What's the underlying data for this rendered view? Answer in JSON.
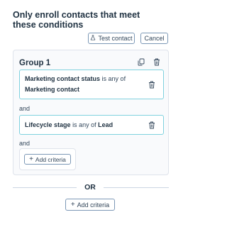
{
  "heading": "Only enroll contacts that meet these conditions",
  "toolbar": {
    "test_label": "Test contact",
    "cancel_label": "Cancel"
  },
  "group": {
    "title": "Group 1",
    "criteria": [
      {
        "property": "Marketing contact status",
        "operator": "is any of",
        "value": "Marketing contact"
      },
      {
        "property": "Lifecycle stage",
        "operator": "is any of",
        "value": "Lead"
      }
    ],
    "connectors": [
      "and",
      "and"
    ],
    "add_criteria_label": "Add criteria"
  },
  "or_label": "OR",
  "add_criteria_label": "Add criteria",
  "colors": {
    "criteria_border": "#7fd1de",
    "button_border": "#7c98b6",
    "text": "#33475b",
    "heading": "#213343"
  },
  "icons": [
    "flask-icon",
    "copy-icon",
    "trash-icon",
    "plus-icon"
  ]
}
